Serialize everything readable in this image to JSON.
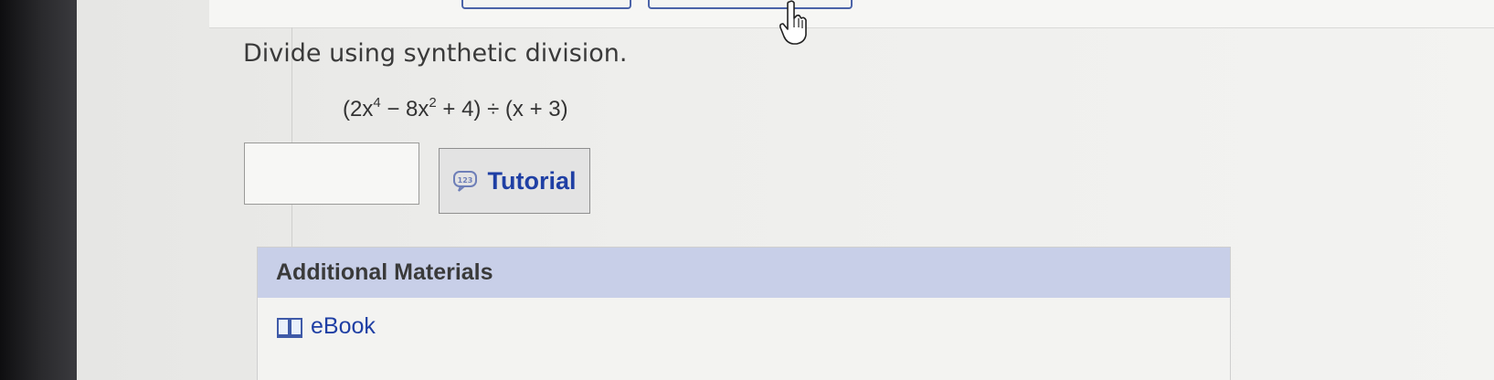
{
  "question": {
    "prompt": "Divide using synthetic division.",
    "expression": {
      "open": "(2x",
      "exp1": "4",
      "mid1": " − 8x",
      "exp2": "2",
      "rest": " + 4) ÷ (x + 3)"
    }
  },
  "answer": {
    "value": ""
  },
  "tutorial": {
    "label": "Tutorial",
    "icon": "tutorial-123-icon"
  },
  "materials": {
    "title": "Additional Materials",
    "items": [
      {
        "label": "eBook",
        "icon": "book-icon"
      }
    ]
  },
  "colors": {
    "link": "#1f3fa4",
    "header_band": "#c8cfe8"
  }
}
